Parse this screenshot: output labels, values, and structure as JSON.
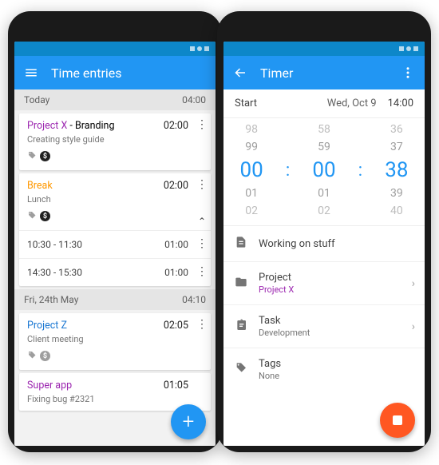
{
  "left": {
    "appbar_title": "Time entries",
    "sections": [
      {
        "label": "Today",
        "total": "04:00"
      },
      {
        "label": "Fri, 24th May",
        "total": "04:10"
      }
    ],
    "entries": {
      "projectX": {
        "project": "Project X",
        "sep": " - ",
        "task": "Branding",
        "desc": "Creating style guide",
        "dur": "02:00"
      },
      "break": {
        "title": "Break",
        "desc": "Lunch",
        "dur": "02:00"
      },
      "break_sub1": {
        "range": "10:30 - 11:30",
        "dur": "01:00"
      },
      "break_sub2": {
        "range": "14:30 - 15:30",
        "dur": "01:00"
      },
      "projectZ": {
        "project": "Project Z",
        "desc": "Client meeting",
        "dur": "02:05"
      },
      "superapp": {
        "project": "Super app",
        "desc": "Fixing bug #2321",
        "dur": "01:05"
      }
    },
    "fab_label": "+"
  },
  "right": {
    "appbar_title": "Timer",
    "start_label": "Start",
    "start_date": "Wed, Oct 9",
    "start_time": "14:00",
    "picker": {
      "h": [
        "98",
        "99",
        "00",
        "01",
        "02"
      ],
      "m": [
        "58",
        "59",
        "00",
        "01",
        "02"
      ],
      "s": [
        "36",
        "37",
        "38",
        "39",
        "40"
      ]
    },
    "note": "Working on stuff",
    "project_label": "Project",
    "project_value": "Project X",
    "task_label": "Task",
    "task_value": "Development",
    "tags_label": "Tags",
    "tags_value": "None"
  }
}
